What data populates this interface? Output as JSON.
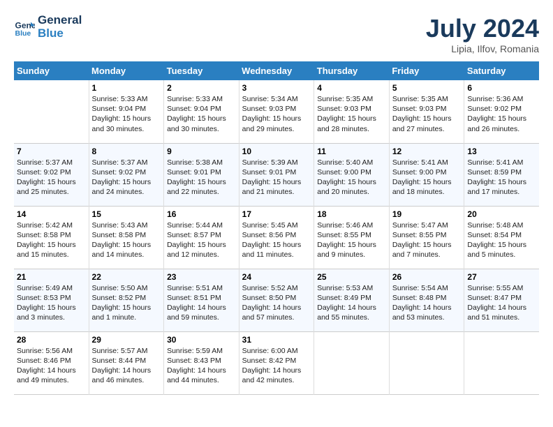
{
  "header": {
    "logo_line1": "General",
    "logo_line2": "Blue",
    "title": "July 2024",
    "subtitle": "Lipia, Ilfov, Romania"
  },
  "columns": [
    "Sunday",
    "Monday",
    "Tuesday",
    "Wednesday",
    "Thursday",
    "Friday",
    "Saturday"
  ],
  "weeks": [
    [
      {
        "day": "",
        "text": ""
      },
      {
        "day": "1",
        "text": "Sunrise: 5:33 AM\nSunset: 9:04 PM\nDaylight: 15 hours\nand 30 minutes."
      },
      {
        "day": "2",
        "text": "Sunrise: 5:33 AM\nSunset: 9:04 PM\nDaylight: 15 hours\nand 30 minutes."
      },
      {
        "day": "3",
        "text": "Sunrise: 5:34 AM\nSunset: 9:03 PM\nDaylight: 15 hours\nand 29 minutes."
      },
      {
        "day": "4",
        "text": "Sunrise: 5:35 AM\nSunset: 9:03 PM\nDaylight: 15 hours\nand 28 minutes."
      },
      {
        "day": "5",
        "text": "Sunrise: 5:35 AM\nSunset: 9:03 PM\nDaylight: 15 hours\nand 27 minutes."
      },
      {
        "day": "6",
        "text": "Sunrise: 5:36 AM\nSunset: 9:02 PM\nDaylight: 15 hours\nand 26 minutes."
      }
    ],
    [
      {
        "day": "7",
        "text": "Sunrise: 5:37 AM\nSunset: 9:02 PM\nDaylight: 15 hours\nand 25 minutes."
      },
      {
        "day": "8",
        "text": "Sunrise: 5:37 AM\nSunset: 9:02 PM\nDaylight: 15 hours\nand 24 minutes."
      },
      {
        "day": "9",
        "text": "Sunrise: 5:38 AM\nSunset: 9:01 PM\nDaylight: 15 hours\nand 22 minutes."
      },
      {
        "day": "10",
        "text": "Sunrise: 5:39 AM\nSunset: 9:01 PM\nDaylight: 15 hours\nand 21 minutes."
      },
      {
        "day": "11",
        "text": "Sunrise: 5:40 AM\nSunset: 9:00 PM\nDaylight: 15 hours\nand 20 minutes."
      },
      {
        "day": "12",
        "text": "Sunrise: 5:41 AM\nSunset: 9:00 PM\nDaylight: 15 hours\nand 18 minutes."
      },
      {
        "day": "13",
        "text": "Sunrise: 5:41 AM\nSunset: 8:59 PM\nDaylight: 15 hours\nand 17 minutes."
      }
    ],
    [
      {
        "day": "14",
        "text": "Sunrise: 5:42 AM\nSunset: 8:58 PM\nDaylight: 15 hours\nand 15 minutes."
      },
      {
        "day": "15",
        "text": "Sunrise: 5:43 AM\nSunset: 8:58 PM\nDaylight: 15 hours\nand 14 minutes."
      },
      {
        "day": "16",
        "text": "Sunrise: 5:44 AM\nSunset: 8:57 PM\nDaylight: 15 hours\nand 12 minutes."
      },
      {
        "day": "17",
        "text": "Sunrise: 5:45 AM\nSunset: 8:56 PM\nDaylight: 15 hours\nand 11 minutes."
      },
      {
        "day": "18",
        "text": "Sunrise: 5:46 AM\nSunset: 8:55 PM\nDaylight: 15 hours\nand 9 minutes."
      },
      {
        "day": "19",
        "text": "Sunrise: 5:47 AM\nSunset: 8:55 PM\nDaylight: 15 hours\nand 7 minutes."
      },
      {
        "day": "20",
        "text": "Sunrise: 5:48 AM\nSunset: 8:54 PM\nDaylight: 15 hours\nand 5 minutes."
      }
    ],
    [
      {
        "day": "21",
        "text": "Sunrise: 5:49 AM\nSunset: 8:53 PM\nDaylight: 15 hours\nand 3 minutes."
      },
      {
        "day": "22",
        "text": "Sunrise: 5:50 AM\nSunset: 8:52 PM\nDaylight: 15 hours\nand 1 minute."
      },
      {
        "day": "23",
        "text": "Sunrise: 5:51 AM\nSunset: 8:51 PM\nDaylight: 14 hours\nand 59 minutes."
      },
      {
        "day": "24",
        "text": "Sunrise: 5:52 AM\nSunset: 8:50 PM\nDaylight: 14 hours\nand 57 minutes."
      },
      {
        "day": "25",
        "text": "Sunrise: 5:53 AM\nSunset: 8:49 PM\nDaylight: 14 hours\nand 55 minutes."
      },
      {
        "day": "26",
        "text": "Sunrise: 5:54 AM\nSunset: 8:48 PM\nDaylight: 14 hours\nand 53 minutes."
      },
      {
        "day": "27",
        "text": "Sunrise: 5:55 AM\nSunset: 8:47 PM\nDaylight: 14 hours\nand 51 minutes."
      }
    ],
    [
      {
        "day": "28",
        "text": "Sunrise: 5:56 AM\nSunset: 8:46 PM\nDaylight: 14 hours\nand 49 minutes."
      },
      {
        "day": "29",
        "text": "Sunrise: 5:57 AM\nSunset: 8:44 PM\nDaylight: 14 hours\nand 46 minutes."
      },
      {
        "day": "30",
        "text": "Sunrise: 5:59 AM\nSunset: 8:43 PM\nDaylight: 14 hours\nand 44 minutes."
      },
      {
        "day": "31",
        "text": "Sunrise: 6:00 AM\nSunset: 8:42 PM\nDaylight: 14 hours\nand 42 minutes."
      },
      {
        "day": "",
        "text": ""
      },
      {
        "day": "",
        "text": ""
      },
      {
        "day": "",
        "text": ""
      }
    ]
  ]
}
